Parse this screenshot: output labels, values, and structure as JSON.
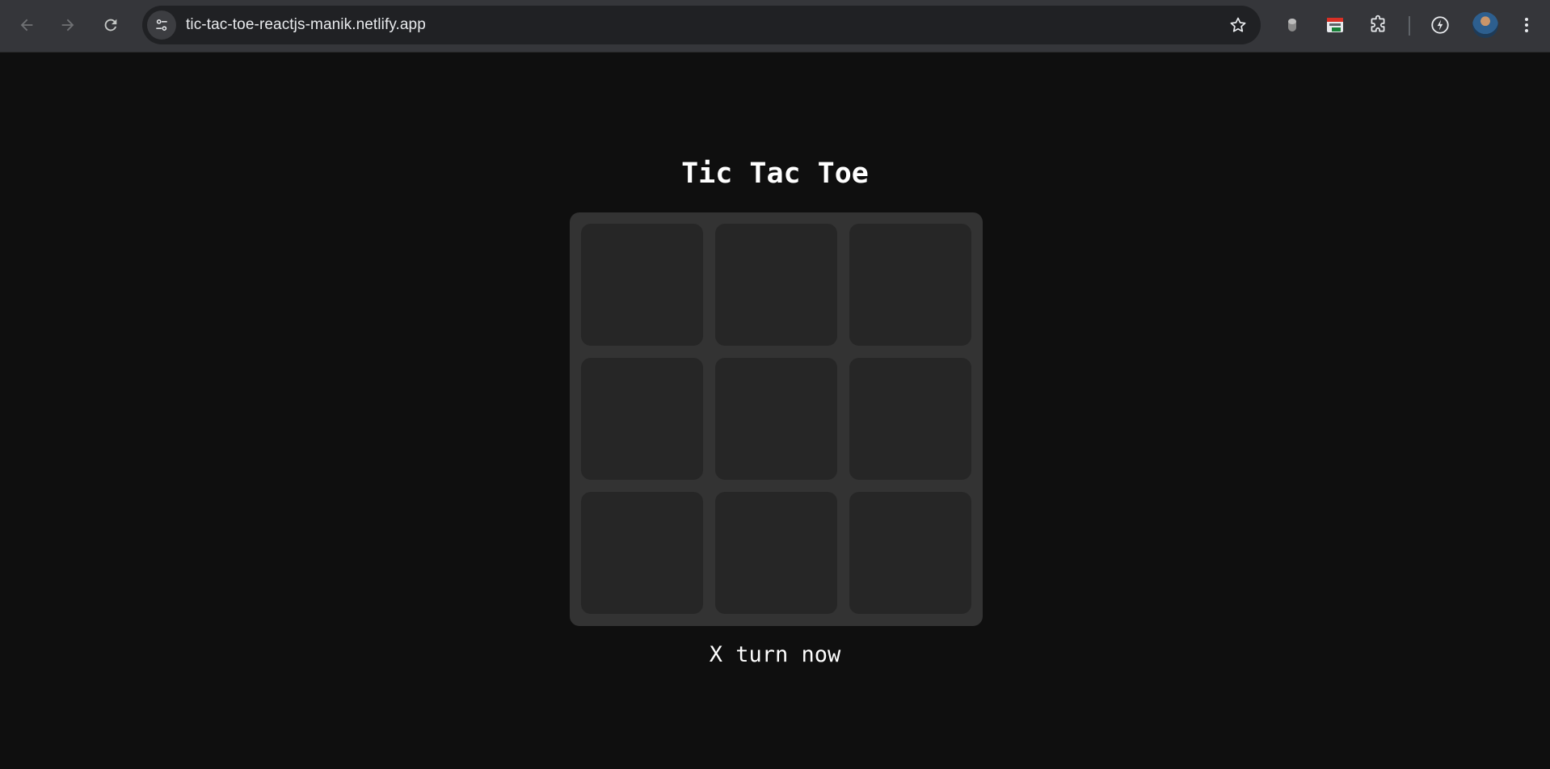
{
  "browser": {
    "url": "tic-tac-toe-reactjs-manik.netlify.app",
    "icons": {
      "back": "arrow-left-icon",
      "forward": "arrow-right-icon",
      "reload": "reload-icon",
      "site_info": "tune-icon",
      "bookmark": "star-icon",
      "extension_1": "mouse-icon",
      "extension_2": "calendar-extension-icon",
      "extensions": "puzzle-icon",
      "performance": "lightning-icon",
      "profile": "avatar",
      "menu": "kebab-menu-icon"
    }
  },
  "game": {
    "title": "Tic Tac Toe",
    "board": [
      "",
      "",
      "",
      "",
      "",
      "",
      "",
      "",
      ""
    ],
    "status": "X turn now"
  },
  "colors": {
    "page_background": "#0f0f0f",
    "board_background": "#333333",
    "cell_background": "#262626",
    "text": "#ffffff"
  }
}
